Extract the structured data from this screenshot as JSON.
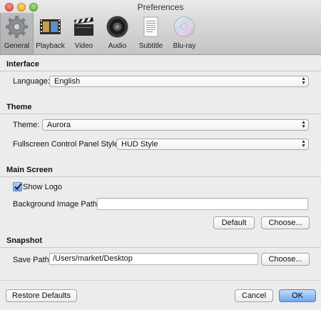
{
  "window": {
    "title": "Preferences"
  },
  "toolbar": {
    "items": [
      {
        "label": "General",
        "icon": "gear-icon",
        "selected": true
      },
      {
        "label": "Playback",
        "icon": "film-strip-icon",
        "selected": false
      },
      {
        "label": "Video",
        "icon": "clapperboard-icon",
        "selected": false
      },
      {
        "label": "Audio",
        "icon": "speaker-icon",
        "selected": false
      },
      {
        "label": "Subtitle",
        "icon": "document-icon",
        "selected": false
      },
      {
        "label": "Blu-ray",
        "icon": "disc-icon",
        "selected": false
      }
    ]
  },
  "interface": {
    "heading": "Interface",
    "language_label": "Language:",
    "language_value": "English"
  },
  "theme": {
    "heading": "Theme",
    "theme_label": "Theme:",
    "theme_value": "Aurora",
    "fullscreen_label": "Fullscreen Control Panel Style:",
    "fullscreen_value": "HUD Style"
  },
  "main_screen": {
    "heading": "Main Screen",
    "show_logo_label": "Show Logo",
    "show_logo_checked": true,
    "bg_path_label": "Background Image Path:",
    "bg_path_value": "",
    "default_button": "Default",
    "choose_button": "Choose..."
  },
  "snapshot": {
    "heading": "Snapshot",
    "save_path_label": "Save Path:",
    "save_path_value": "/Users/market/Desktop",
    "choose_button": "Choose..."
  },
  "footer": {
    "restore_button": "Restore Defaults",
    "cancel_button": "Cancel",
    "ok_button": "OK"
  },
  "colors": {
    "accent": "#6ea6ef"
  }
}
